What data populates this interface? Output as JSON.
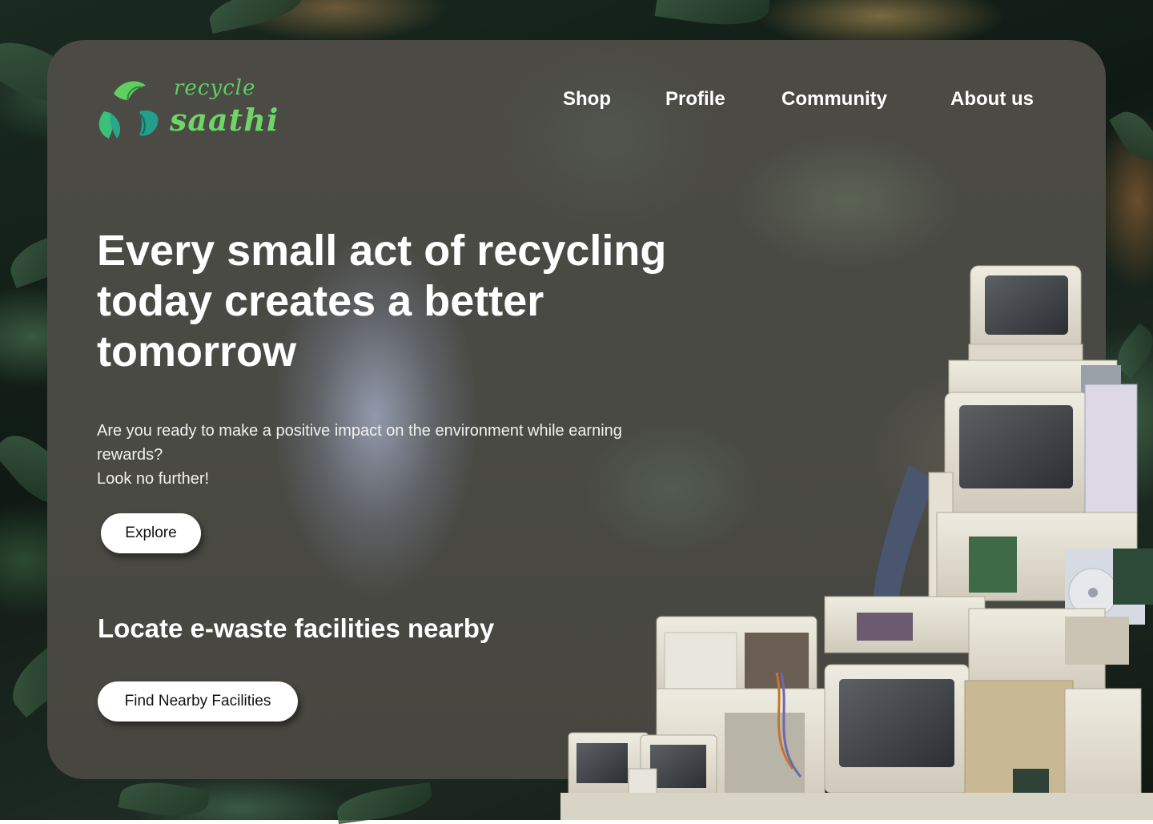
{
  "brand": {
    "word1": "recycle",
    "word2": "saathi"
  },
  "nav": {
    "items": [
      {
        "label": "Shop"
      },
      {
        "label": "Profile"
      },
      {
        "label": "Community"
      },
      {
        "label": "About us"
      }
    ]
  },
  "hero": {
    "title": "Every small act of recycling today creates a better tomorrow",
    "subtitle_line1": "Are you ready to make a positive impact on the environment while earning rewards?",
    "subtitle_line2": "Look no further!",
    "cta_label": "Explore"
  },
  "facilities": {
    "heading": "Locate e-waste facilities nearby",
    "button_label": "Find Nearby Facilities"
  },
  "colors": {
    "brand_green": "#5ccf62",
    "leaf_teal": "#2aa68a",
    "card_bg": "#4a4a45",
    "text": "#ffffff",
    "button_bg": "#ffffff"
  }
}
